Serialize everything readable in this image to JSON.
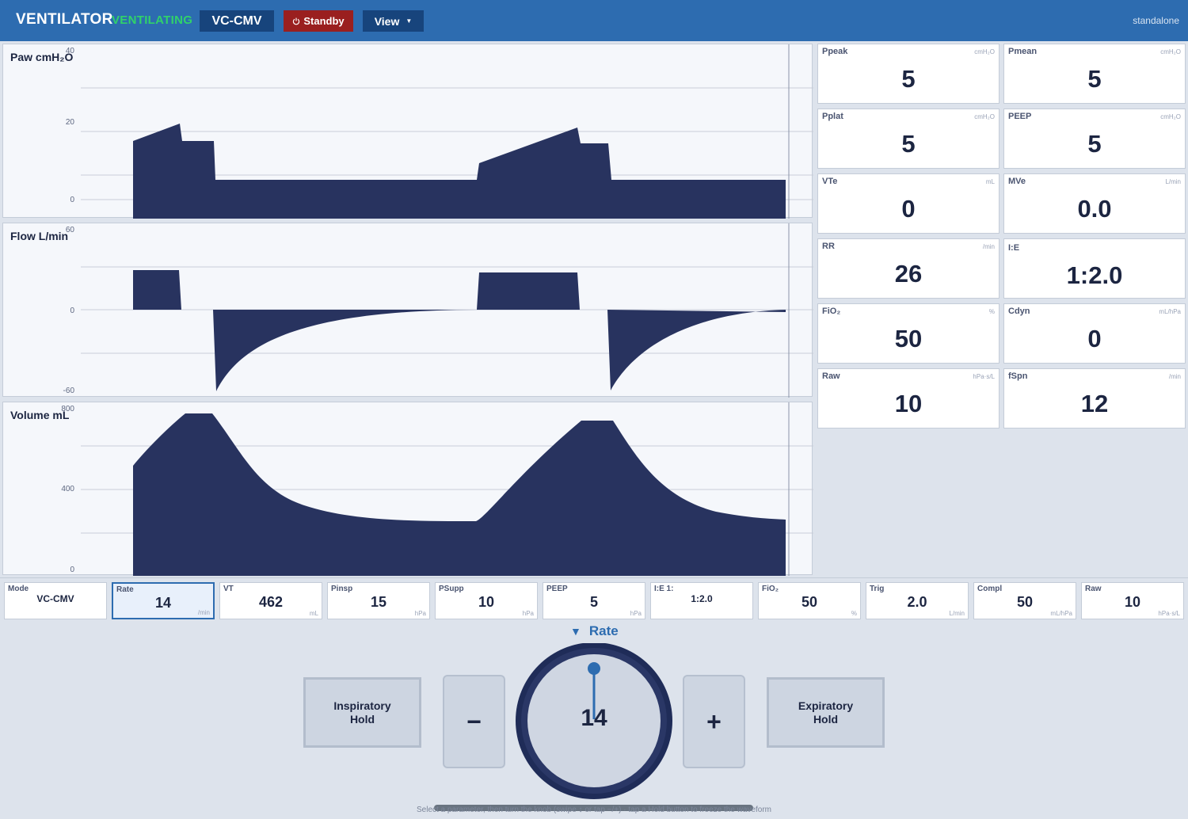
{
  "header": {
    "title": "VENTILATOR",
    "status": "VENTILATING",
    "mode_button": "VC-CMV",
    "standby_icon": "power-icon",
    "standby_label": "Standby",
    "view_label": "View",
    "right_label": "standalone",
    "colors": {
      "bar": "#2d6cb0",
      "status": "#30d26a",
      "standby": "#9a1f1f"
    }
  },
  "waveforms": {
    "paw": {
      "label": "Paw  cmH₂O",
      "ticks": [
        "40",
        "20",
        "0"
      ]
    },
    "flow": {
      "label": "Flow  L/min",
      "ticks": [
        "60",
        "0",
        "-60"
      ]
    },
    "volume": {
      "label": "Volume  mL",
      "ticks": [
        "800",
        "400",
        "0"
      ]
    },
    "fill_color": "#28335f"
  },
  "metrics": [
    {
      "name": "Ppeak",
      "unit": "cmH₂O",
      "value": "5"
    },
    {
      "name": "Pmean",
      "unit": "cmH₂O",
      "value": "5"
    },
    {
      "name": "Pplat",
      "unit": "cmH₂O",
      "value": "5"
    },
    {
      "name": "PEEP",
      "unit": "cmH₂O",
      "value": "5"
    },
    {
      "name": "VTe",
      "unit": "mL",
      "value": "0"
    },
    {
      "name": "MVe",
      "unit": "L/min",
      "value": "0.0"
    },
    {
      "name": "RR",
      "unit": "/min",
      "value": "26"
    },
    {
      "name": "I:E",
      "unit": "",
      "value": "1:2.0"
    },
    {
      "name": "FiO₂",
      "unit": "%",
      "value": "50"
    },
    {
      "name": "Cdyn",
      "unit": "mL/hPa",
      "value": "0"
    },
    {
      "name": "Raw",
      "unit": "hPa·s/L",
      "value": "10"
    },
    {
      "name": "fSpn",
      "unit": "/min",
      "value": "12"
    }
  ],
  "settings": [
    {
      "name": "Mode",
      "value": "VC-CMV",
      "unit": ""
    },
    {
      "name": "Rate",
      "value": "14",
      "unit": "/min",
      "active": true
    },
    {
      "name": "VT",
      "value": "462",
      "unit": "mL"
    },
    {
      "name": "Pinsp",
      "value": "15",
      "unit": "hPa"
    },
    {
      "name": "PSupp",
      "value": "10",
      "unit": "hPa"
    },
    {
      "name": "PEEP",
      "value": "5",
      "unit": "hPa"
    },
    {
      "name": "I:E 1:",
      "value": "1:2.0",
      "unit": ""
    },
    {
      "name": "FiO₂",
      "value": "50",
      "unit": "%"
    },
    {
      "name": "Trig",
      "value": "2.0",
      "unit": "L/min"
    },
    {
      "name": "Compl",
      "value": "50",
      "unit": "mL/hPa"
    },
    {
      "name": "Raw",
      "value": "10",
      "unit": "hPa·s/L"
    }
  ],
  "controls": {
    "selected_param": "Rate",
    "knob_value": "14",
    "insp_hold": "Inspiratory\nHold",
    "exp_hold": "Expiratory\nHold",
    "minus": "−",
    "plus": "+",
    "hint": "Select a parameter, then turn the knob (swipe ↕ or tap −/+) · tap a Hold button to freeze the waveform"
  }
}
